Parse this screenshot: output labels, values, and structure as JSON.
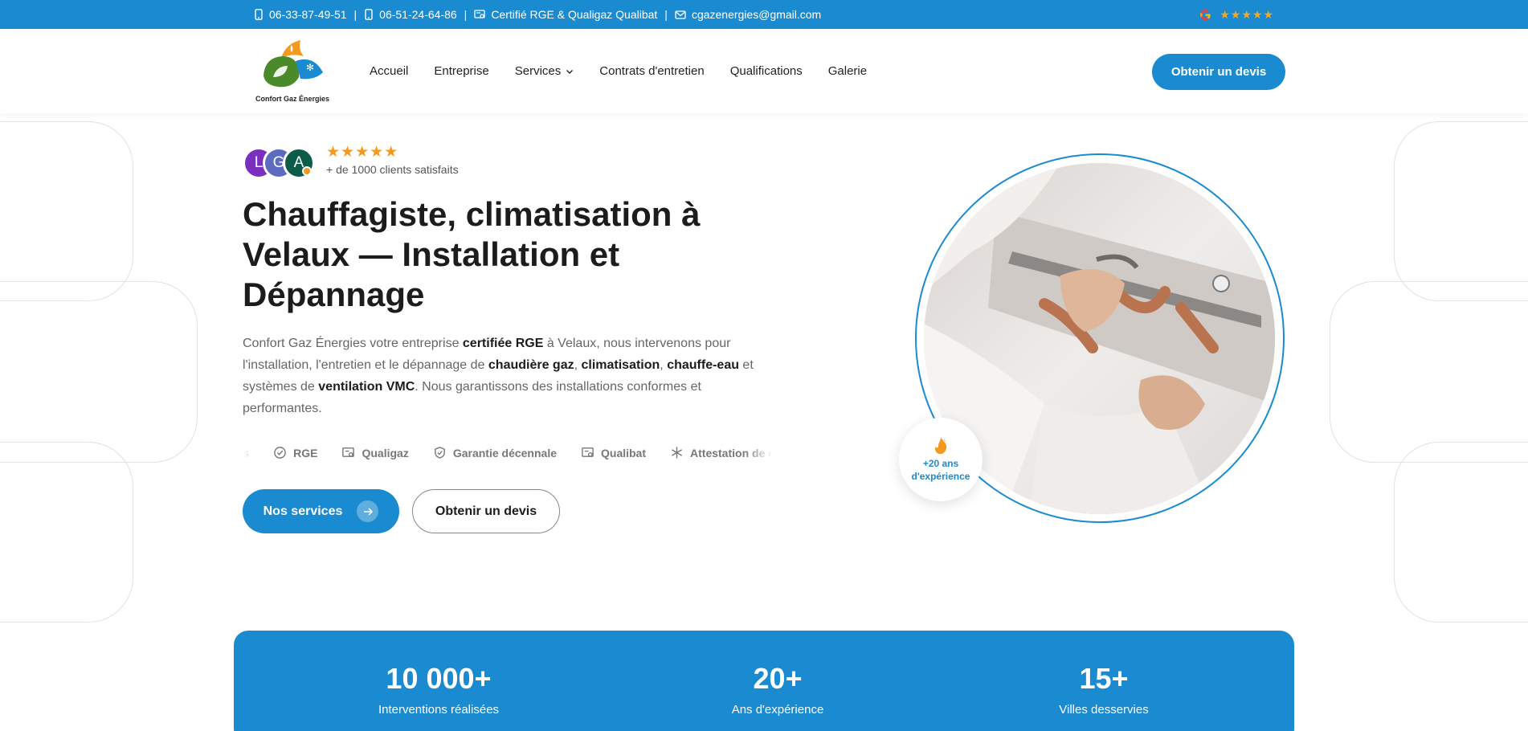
{
  "topbar": {
    "phone1": "06-33-87-49-51",
    "phone2": "06-51-24-64-86",
    "cert": "Certifié RGE & Qualigaz Qualibat",
    "email": "cgazenergies@gmail.com",
    "separator": "|",
    "stars": "★★★★★"
  },
  "logo": {
    "text": "Confort Gaz Énergies"
  },
  "nav": {
    "items": [
      "Accueil",
      "Entreprise",
      "Services",
      "Contrats d'entretien",
      "Qualifications",
      "Galerie"
    ],
    "cta": "Obtenir un devis"
  },
  "hero": {
    "avatars": [
      "L",
      "G",
      "A"
    ],
    "avatar_colors": [
      "#7b2fbf",
      "#5c6bc0",
      "#0d5c4a"
    ],
    "stars": "★★★★★",
    "clients_text": "+ de 1000 clients satisfaits",
    "title": "Chauffagiste, climatisation à Velaux — Installation et Dépannage",
    "desc": {
      "p1": "Confort Gaz Énergies votre entreprise ",
      "b1": "certifiée RGE",
      "p2": " à Velaux, nous intervenons pour l'installation, l'entretien et le dépannage de ",
      "b2": "chaudière gaz",
      "p3": ", ",
      "b3": "climatisation",
      "p4": ", ",
      "b4": "chauffe-eau",
      "p5": " et systèmes de ",
      "b5": "ventilation VMC",
      "p6": ". Nous garantissons des installations conformes et performantes."
    },
    "badges": [
      "nes",
      "RGE",
      "Qualigaz",
      "Garantie décennale",
      "Qualibat",
      "Attestation de capacité"
    ],
    "btn_services": "Nos services",
    "btn_devis": "Obtenir un devis",
    "experience": "+20 ans d'expérience"
  },
  "stats": [
    {
      "value": "10 000+",
      "label": "Interventions réalisées"
    },
    {
      "value": "20+",
      "label": "Ans d'expérience"
    },
    {
      "value": "15+",
      "label": "Villes desservies"
    }
  ],
  "colors": {
    "primary": "#1a8bd0",
    "accent": "#f39a1e",
    "text": "#1c1c1c"
  }
}
